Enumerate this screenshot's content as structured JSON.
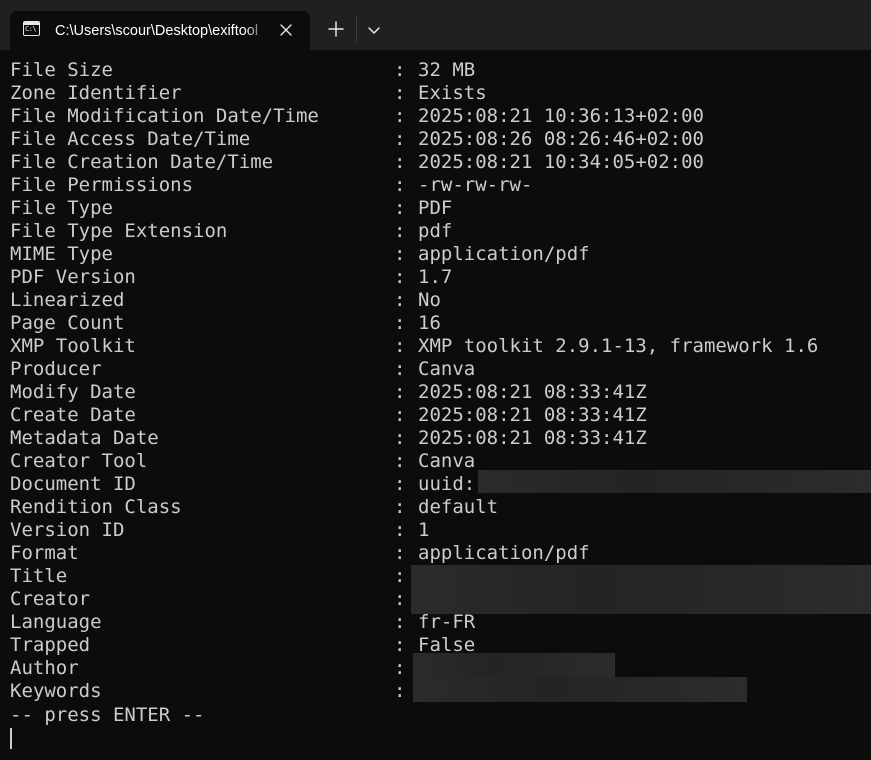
{
  "window": {
    "tab_title": "C:\\Users\\scour\\Desktop\\exiftool",
    "tab_icon_text": "C:\\"
  },
  "terminal": {
    "separator": ":",
    "rows": [
      {
        "key": "File Size",
        "value": "32 MB"
      },
      {
        "key": "Zone Identifier",
        "value": "Exists"
      },
      {
        "key": "File Modification Date/Time",
        "value": "2025:08:21 10:36:13+02:00"
      },
      {
        "key": "File Access Date/Time",
        "value": "2025:08:26 08:26:46+02:00"
      },
      {
        "key": "File Creation Date/Time",
        "value": "2025:08:21 10:34:05+02:00"
      },
      {
        "key": "File Permissions",
        "value": "-rw-rw-rw-"
      },
      {
        "key": "File Type",
        "value": "PDF"
      },
      {
        "key": "File Type Extension",
        "value": "pdf"
      },
      {
        "key": "MIME Type",
        "value": "application/pdf"
      },
      {
        "key": "PDF Version",
        "value": "1.7"
      },
      {
        "key": "Linearized",
        "value": "No"
      },
      {
        "key": "Page Count",
        "value": "16"
      },
      {
        "key": "XMP Toolkit",
        "value": "XMP toolkit 2.9.1-13, framework 1.6"
      },
      {
        "key": "Producer",
        "value": "Canva"
      },
      {
        "key": "Modify Date",
        "value": "2025:08:21 08:33:41Z"
      },
      {
        "key": "Create Date",
        "value": "2025:08:21 08:33:41Z"
      },
      {
        "key": "Metadata Date",
        "value": "2025:08:21 08:33:41Z"
      },
      {
        "key": "Creator Tool",
        "value": "Canva"
      },
      {
        "key": "Document ID",
        "value": "uuid:"
      },
      {
        "key": "Rendition Class",
        "value": "default"
      },
      {
        "key": "Version ID",
        "value": "1"
      },
      {
        "key": "Format",
        "value": "application/pdf"
      },
      {
        "key": "Title",
        "value": ""
      },
      {
        "key": "Creator",
        "value": ""
      },
      {
        "key": "Language",
        "value": "fr-FR"
      },
      {
        "key": "Trapped",
        "value": "False"
      },
      {
        "key": "Author",
        "value": ""
      },
      {
        "key": "Keywords",
        "value": ""
      }
    ],
    "prompt": "-- press ENTER --"
  },
  "icons": {
    "tab": "terminal-icon",
    "close": "close-icon",
    "new_tab": "plus-icon",
    "dropdown": "chevron-down-icon"
  },
  "colors": {
    "background": "#0c0c0c",
    "tabbar": "#202020",
    "text": "#cccccc"
  }
}
